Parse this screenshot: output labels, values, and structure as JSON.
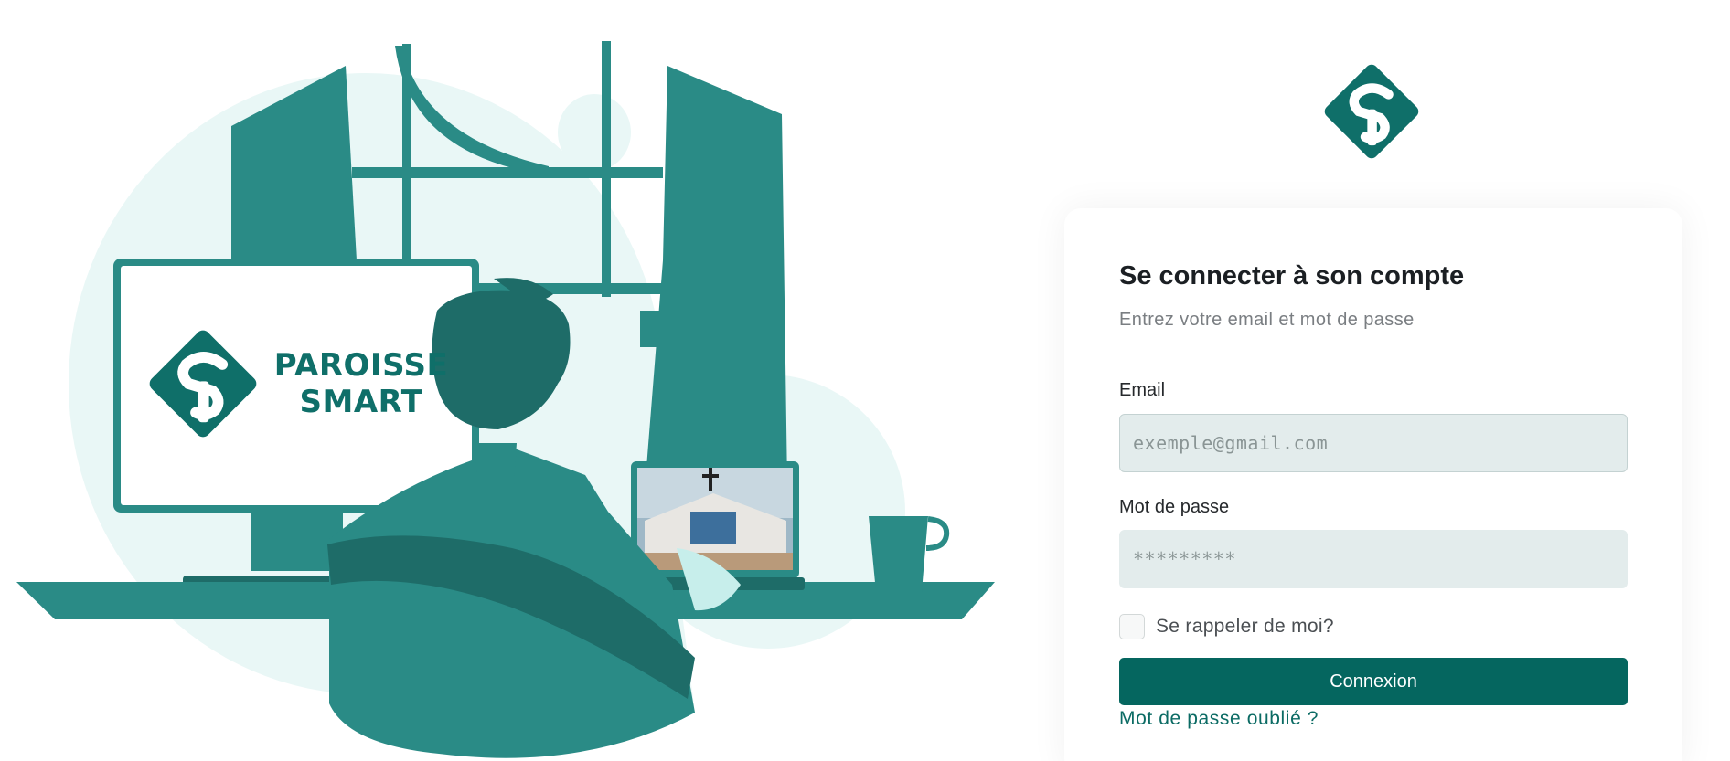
{
  "brand": {
    "line1": "PAROISSE",
    "line2": "SMART",
    "color": "#0f6f69"
  },
  "login": {
    "title": "Se connecter à son compte",
    "subtitle": "Entrez votre email et mot de passe",
    "email_label": "Email",
    "email_placeholder": "exemple@gmail.com",
    "password_label": "Mot de passe",
    "password_placeholder": "*********",
    "remember_label": "Se rappeler de moi?",
    "remember_checked": false,
    "submit_label": "Connexion",
    "forgot_label": "Mot de passe oublié ?"
  },
  "colors": {
    "primary": "#05665f",
    "illustration": "#2a8b86",
    "illustration_dark": "#1e6c68",
    "background_blob": "#e9f7f6"
  }
}
